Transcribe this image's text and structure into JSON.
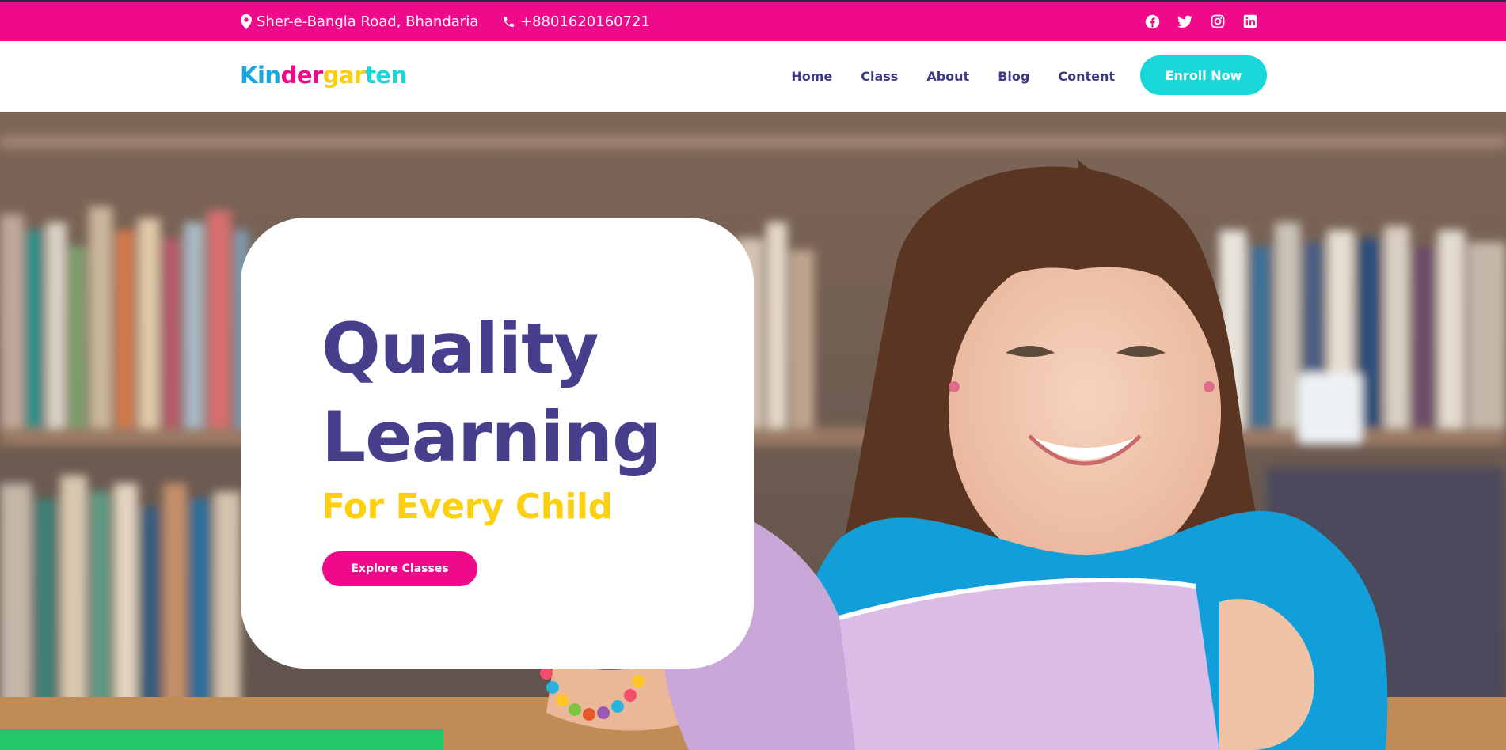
{
  "colors": {
    "brand_pink": "#ef0a8b",
    "brand_cyan": "#19d7d9",
    "brand_purple": "#463f8c",
    "brand_yellow": "#fbcf12",
    "nav_text": "#3c3a86"
  },
  "topbar": {
    "address": "Sher-e-Bangla Road, Bhandaria",
    "address_icon": "map-pin-icon",
    "phone": "+8801620160721",
    "phone_icon": "phone-icon",
    "socials": [
      {
        "icon": "facebook-icon"
      },
      {
        "icon": "twitter-icon"
      },
      {
        "icon": "instagram-icon"
      },
      {
        "icon": "linkedin-icon"
      }
    ]
  },
  "logo": {
    "parts": [
      {
        "text": "Kin",
        "color": "#19a7e0"
      },
      {
        "text": "der",
        "color": "#ef0a8b"
      },
      {
        "text": "gar",
        "color": "#fbcf12"
      },
      {
        "text": "ten",
        "color": "#19d7d9"
      }
    ]
  },
  "nav": {
    "items": [
      {
        "label": "Home"
      },
      {
        "label": "Class"
      },
      {
        "label": "About"
      },
      {
        "label": "Blog"
      },
      {
        "label": "Content"
      }
    ],
    "cta_label": "Enroll Now"
  },
  "hero": {
    "headline_line1": "Quality",
    "headline_line2": "Learning",
    "subheadline": "For Every Child",
    "button_label": "Explore Classes"
  }
}
